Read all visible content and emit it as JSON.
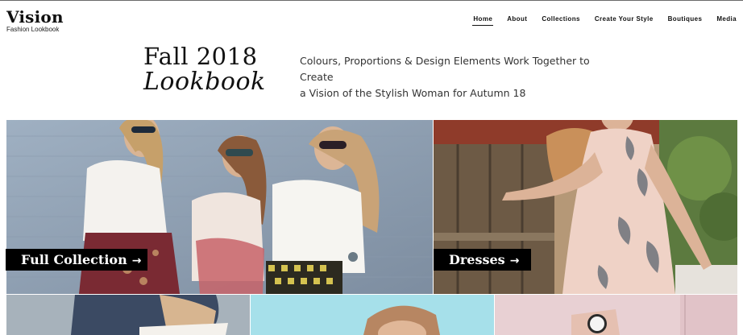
{
  "brand": {
    "title": "Vision",
    "subtitle": "Fashion Lookbook"
  },
  "nav": {
    "items": [
      {
        "label": "Home",
        "active": true
      },
      {
        "label": "About"
      },
      {
        "label": "Collections"
      },
      {
        "label": "Create Your Style"
      },
      {
        "label": "Boutiques"
      },
      {
        "label": "Media"
      }
    ]
  },
  "hero": {
    "title_line1": "Fall 2018",
    "title_line2": "Lookbook",
    "tagline_line1": "Colours, Proportions & Design Elements Work Together to Create",
    "tagline_line2": "a Vision of the Stylish Woman for Autumn 18"
  },
  "tiles": {
    "full_collection": {
      "label": "Full Collection",
      "arrow": "→"
    },
    "dresses": {
      "label": "Dresses",
      "arrow": "→"
    }
  },
  "colors": {
    "text": "#111111",
    "cta_background": "#000000",
    "cta_text": "#ffffff",
    "accent_sky": "#a5e0ea"
  }
}
